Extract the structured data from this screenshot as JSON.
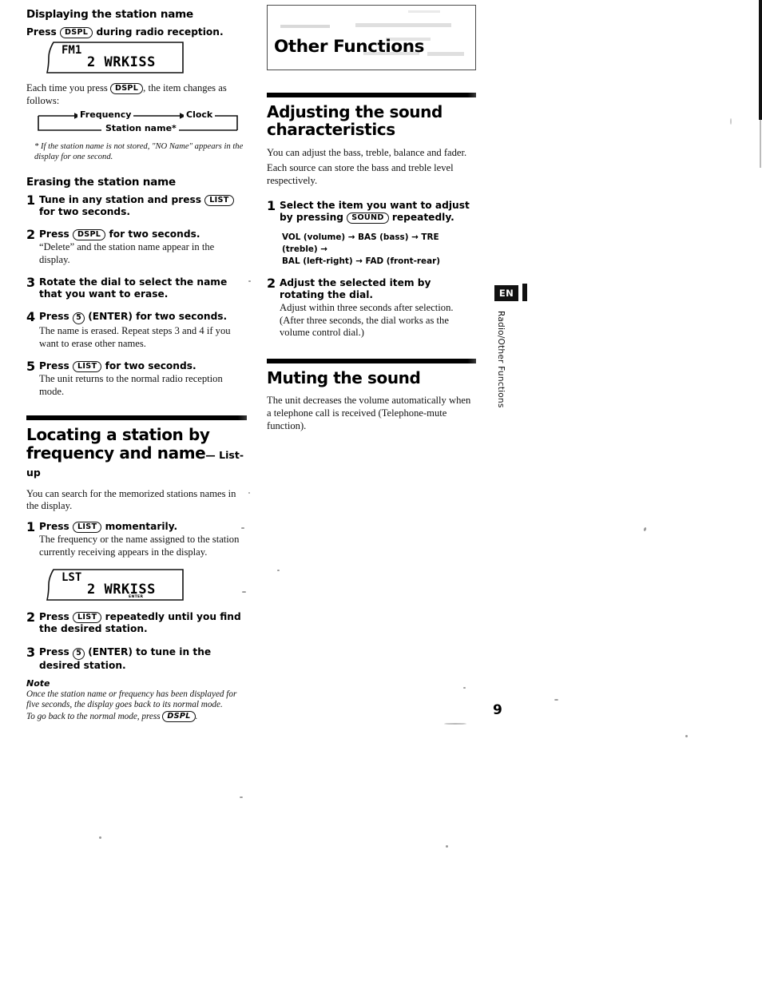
{
  "page": {
    "number": "9",
    "language_badge": "EN",
    "side_label": "Radio/Other Functions"
  },
  "left_column": {
    "section_displaying": {
      "heading": "Displaying the station name",
      "intro_pre": "Press",
      "intro_key": "DSPL",
      "intro_post": "during radio reception.",
      "lcd": {
        "top": "FM1",
        "main": "2 WRKISS",
        "tiny": ""
      },
      "after_pre": "Each time you press",
      "after_key": "DSPL",
      "after_post": ", the item changes as follows:",
      "flow": {
        "frequency": "Frequency",
        "clock": "Clock",
        "station_name": "Station name*"
      },
      "footnote": "* If the station name is not stored, \"NO Name\" appears in the display for one second."
    },
    "section_erasing": {
      "heading": "Erasing the station name",
      "steps": [
        {
          "num": "1",
          "lead_pre": "Tune in any station and press",
          "lead_key": "LIST",
          "lead_post": "for two seconds.",
          "detail": ""
        },
        {
          "num": "2",
          "lead_pre": "Press",
          "lead_key": "DSPL",
          "lead_post": "for two seconds.",
          "detail": "“Delete” and the station name appear in the display."
        },
        {
          "num": "3",
          "lead_pre": "Rotate the dial to select the name that you want to erase.",
          "lead_key": "",
          "lead_post": "",
          "detail": ""
        },
        {
          "num": "4",
          "lead_pre": "Press",
          "lead_key": "5",
          "lead_post": "(ENTER) for two seconds.",
          "detail": "The name is erased. Repeat steps 3 and 4 if you want to erase other names."
        },
        {
          "num": "5",
          "lead_pre": "Press",
          "lead_key": "LIST",
          "lead_post": "for two seconds.",
          "detail": "The unit returns to the normal radio reception mode."
        }
      ]
    },
    "section_locating": {
      "heading_line1": "Locating a station by",
      "heading_line2": "frequency and name",
      "heading_suffix": "— List-up",
      "intro": "You can search for the memorized stations names in the display.",
      "steps": [
        {
          "num": "1",
          "lead_pre": "Press",
          "lead_key": "LIST",
          "lead_post": "momentarily.",
          "detail": "The frequency or the name assigned to the station currently receiving appears in the display."
        },
        {
          "num": "2",
          "lead_pre": "Press",
          "lead_key": "LIST",
          "lead_post": "repeatedly until you find the desired station.",
          "detail": ""
        },
        {
          "num": "3",
          "lead_pre": "Press",
          "lead_key": "5",
          "lead_post": "(ENTER) to tune in the desired station.",
          "detail": ""
        }
      ],
      "lcd": {
        "top": "LST",
        "main": "2 WRKISS",
        "tiny": "ENTER"
      },
      "note_title": "Note",
      "note_line1": "Once the station name or frequency has been displayed for",
      "note_line2": "five seconds, the display goes back to its normal mode.",
      "note_line3_pre": "To go back to the normal mode, press",
      "note_line3_key": "DSPL",
      "note_line3_post": "."
    }
  },
  "right_column": {
    "banner_title": "Other Functions",
    "section_sound": {
      "heading_line1": "Adjusting the sound",
      "heading_line2": "characteristics",
      "intro_line1": "You can adjust the bass, treble, balance and fader.",
      "intro_line2": "Each source can store the bass and treble level respectively.",
      "steps": [
        {
          "num": "1",
          "lead_pre": "Select the item you want to adjust by pressing",
          "lead_key": "SOUND",
          "lead_post": "repeatedly.",
          "detail": ""
        },
        {
          "num": "2",
          "lead_pre": "Adjust the selected item by rotating the dial.",
          "lead_key": "",
          "lead_post": "",
          "detail": "Adjust within three seconds after selection. (After three seconds, the dial works as the volume control dial.)"
        }
      ],
      "sequence_line1": "VOL (volume) →  BAS (bass) → TRE (treble)  →",
      "sequence_line2": "BAL (left-right) → FAD (front-rear)"
    },
    "section_muting": {
      "heading": "Muting the sound",
      "body": "The unit decreases the volume automatically when a telephone call is received (Telephone-mute function)."
    }
  }
}
